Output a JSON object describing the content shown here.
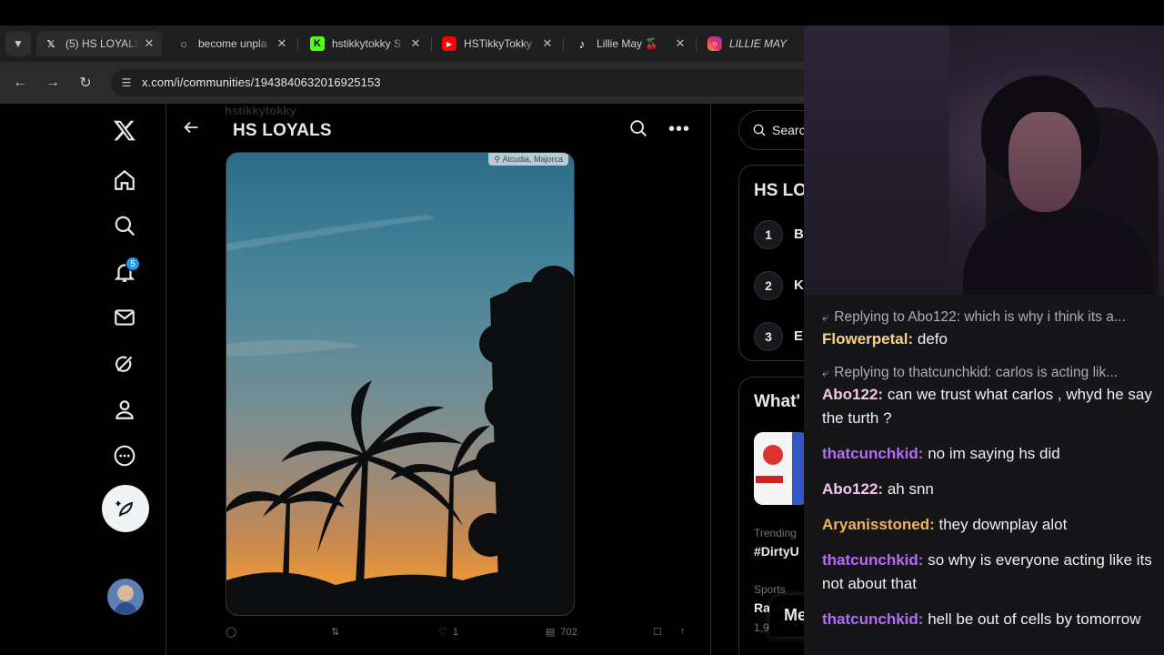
{
  "browser": {
    "tabs": [
      {
        "icon": "x-logo-icon",
        "title": "(5) HS LOYALS",
        "active": true
      },
      {
        "icon": "globe-icon",
        "title": "become unpla",
        "active": false
      },
      {
        "icon": "kick-logo-icon",
        "title": "hstikkytokky S",
        "active": false
      },
      {
        "icon": "youtube-logo-icon",
        "title": "HSTikkyTokky",
        "active": false
      },
      {
        "icon": "tiktok-logo-icon",
        "title": "Lillie May 🍒",
        "active": false
      },
      {
        "icon": "instagram-logo-icon",
        "title": "LILLIE MAY",
        "active": false
      }
    ],
    "url": "x.com/i/communities/1943840632016925153"
  },
  "sidenav": {
    "items": [
      "x-logo",
      "home",
      "explore",
      "notifications",
      "messages",
      "grok",
      "profile",
      "more"
    ],
    "notification_count": "5"
  },
  "main": {
    "ghost_header": "hstikkytokky",
    "community_title": "HS LOYALS",
    "post": {
      "location": "Alcudia, Majorca",
      "likes": "1",
      "views": "702"
    }
  },
  "right": {
    "search_placeholder": "Search",
    "community_heading": "HS LO",
    "ranks": [
      {
        "n": "1",
        "name": "B"
      },
      {
        "n": "2",
        "name": "K"
      },
      {
        "n": "3",
        "name": "E"
      }
    ],
    "whats_heading": "What'",
    "trend1_meta": "Trending",
    "trend1_name": "#DirtyU",
    "trend2_meta": "Sports",
    "trend2_name": "Ra",
    "trend2_count": "1,9",
    "messages_label": "Me"
  },
  "chat": {
    "colors": {
      "Flowerpetal": "#f7d08a",
      "Abo122": "#f2c6e6",
      "thatcunchkid": "#b56cf2",
      "Aryanisstoned": "#f0b35a"
    },
    "entries": [
      {
        "reply": "Replying to Abo122: which is why i think its a...",
        "user": "Flowerpetal",
        "text": "defo"
      },
      {
        "reply": "Replying to thatcunchkid: carlos is acting lik...",
        "user": "Abo122",
        "text": "can we trust what carlos , whyd he say the turth ?"
      },
      {
        "reply": null,
        "user": "thatcunchkid",
        "text": "no im saying hs did"
      },
      {
        "reply": null,
        "user": "Abo122",
        "text": "ah snn"
      },
      {
        "reply": null,
        "user": "Aryanisstoned",
        "text": "they downplay alot"
      },
      {
        "reply": null,
        "user": "thatcunchkid",
        "text": "so why is everyone acting like its not about that"
      },
      {
        "reply": null,
        "user": "thatcunchkid",
        "text": "hell be out of cells by tomorrow"
      }
    ]
  }
}
